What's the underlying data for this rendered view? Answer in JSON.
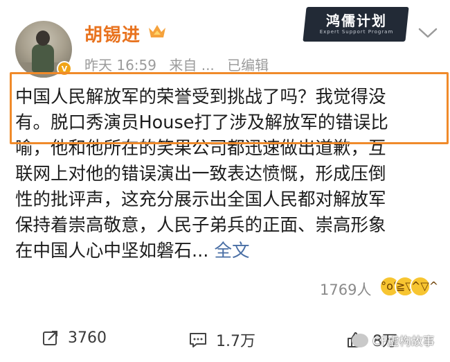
{
  "post": {
    "author": "胡锡进",
    "time": "昨天 16:59",
    "source": "来自 ...",
    "edited": "已编辑",
    "text_lines": [
      "中国人民解放军的荣誉受到挑战了吗？我觉得没",
      "有。脱口秀演员House打了涉及解放军的错误比",
      "喻，他和他所在的笑果公司都迅速做出道歉，互",
      "联网上对他的错误演出一致表达愤慨，形成压倒",
      "性的批评声，这充分展示出全国人民都对解放军",
      "保持着崇高敬意，人民子弟兵的正面、崇高形象",
      "在中国人心中坚如磐石..."
    ],
    "more_link": "全文",
    "reactions_count": "1769人",
    "reposts": "3760",
    "comments": "1.7万",
    "likes": "8万"
  },
  "banner": {
    "title": "鸿儒计划",
    "subtitle": "Expert Support Program"
  },
  "watermark": "CF虚构故事",
  "icons": {
    "verified": "verified-v-badge-icon",
    "rank": "crown-rank-icon",
    "menu": "chevron-down-icon",
    "repost": "repost-icon",
    "comment": "comment-icon",
    "like": "thumbs-up-icon"
  },
  "colors": {
    "author": "#e8731f",
    "highlight": "#f08a2a",
    "link": "#4a6fa5",
    "meta": "#9b9b9b"
  }
}
